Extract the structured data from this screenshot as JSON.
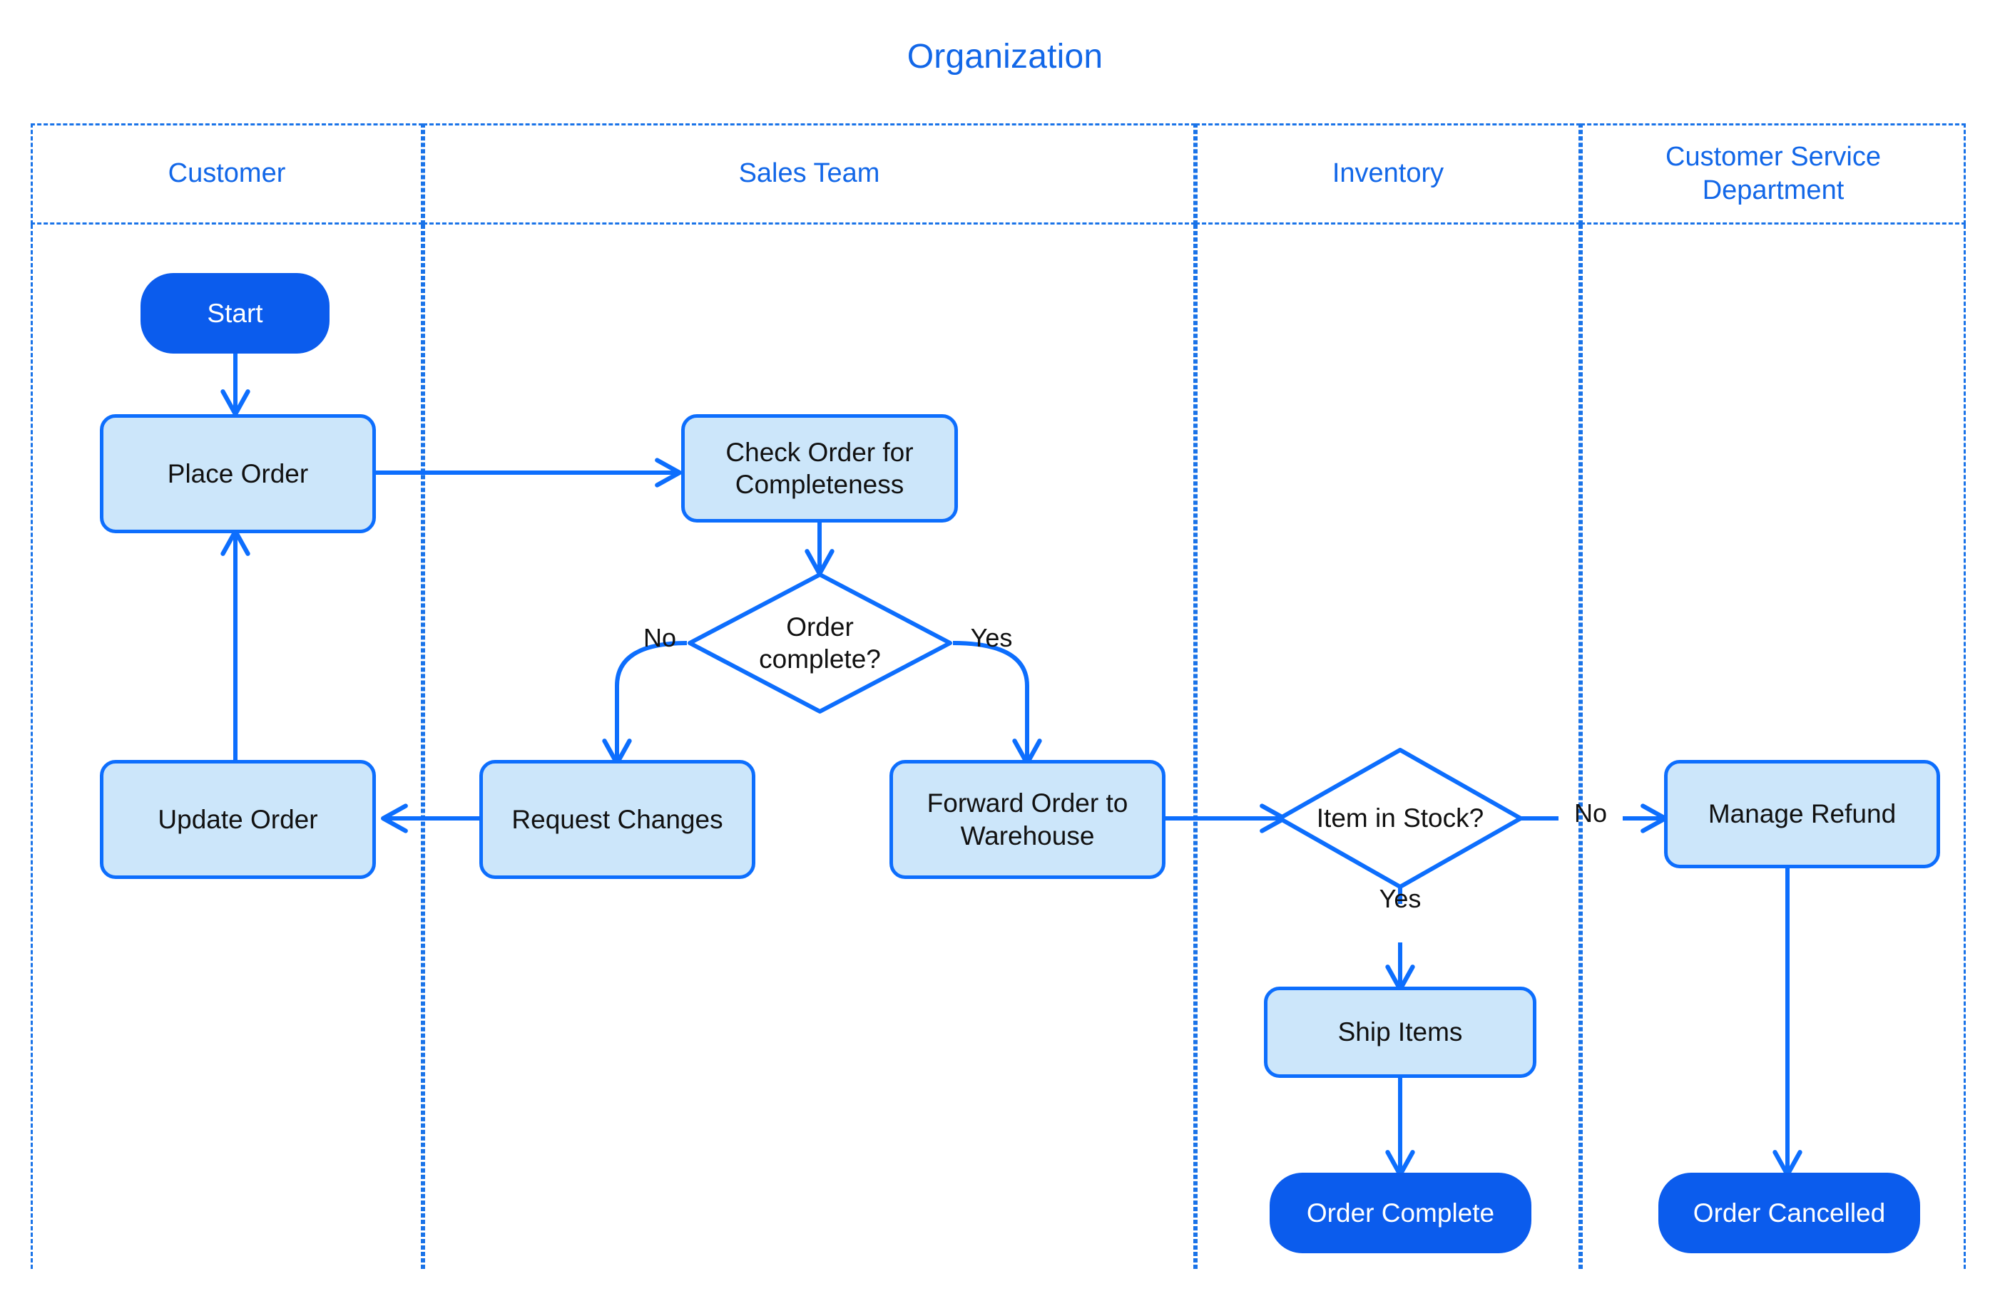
{
  "diagram": {
    "title": "Organization",
    "type": "swimlane-flowchart",
    "colors": {
      "accent": "#1267e8",
      "lane_border": "#1a73e8",
      "node_border": "#0d6efd",
      "process_fill": "#cce6fa",
      "terminator_fill": "#0b5ced",
      "terminator_text": "#ffffff",
      "node_text": "#111111",
      "connector": "#0d6efd"
    }
  },
  "lanes": [
    {
      "id": "customer",
      "label": "Customer"
    },
    {
      "id": "sales",
      "label": "Sales Team"
    },
    {
      "id": "inventory",
      "label": "Inventory"
    },
    {
      "id": "service",
      "label": "Customer Service Department"
    }
  ],
  "nodes": [
    {
      "id": "start",
      "label": "Start",
      "shape": "terminator",
      "lane": "customer"
    },
    {
      "id": "place-order",
      "label": "Place Order",
      "shape": "process",
      "lane": "customer"
    },
    {
      "id": "update-order",
      "label": "Update Order",
      "shape": "process",
      "lane": "customer"
    },
    {
      "id": "check-order",
      "label": "Check Order for Completeness",
      "shape": "process",
      "lane": "sales"
    },
    {
      "id": "order-complete",
      "label": "Order complete?",
      "shape": "decision",
      "lane": "sales"
    },
    {
      "id": "request-changes",
      "label": "Request Changes",
      "shape": "process",
      "lane": "sales"
    },
    {
      "id": "forward-order",
      "label": "Forward Order to Warehouse",
      "shape": "process",
      "lane": "sales"
    },
    {
      "id": "item-in-stock",
      "label": "Item in Stock?",
      "shape": "decision",
      "lane": "inventory"
    },
    {
      "id": "ship-items",
      "label": "Ship Items",
      "shape": "process",
      "lane": "inventory"
    },
    {
      "id": "order-complete-end",
      "label": "Order Complete",
      "shape": "terminator",
      "lane": "inventory"
    },
    {
      "id": "manage-refund",
      "label": "Manage Refund",
      "shape": "process",
      "lane": "service"
    },
    {
      "id": "order-cancelled",
      "label": "Order Cancelled",
      "shape": "terminator",
      "lane": "service"
    }
  ],
  "edges": [
    {
      "from": "start",
      "to": "place-order",
      "label": ""
    },
    {
      "from": "place-order",
      "to": "check-order",
      "label": ""
    },
    {
      "from": "check-order",
      "to": "order-complete",
      "label": ""
    },
    {
      "from": "order-complete",
      "to": "request-changes",
      "label": "No"
    },
    {
      "from": "order-complete",
      "to": "forward-order",
      "label": "Yes"
    },
    {
      "from": "request-changes",
      "to": "update-order",
      "label": ""
    },
    {
      "from": "update-order",
      "to": "place-order",
      "label": ""
    },
    {
      "from": "forward-order",
      "to": "item-in-stock",
      "label": ""
    },
    {
      "from": "item-in-stock",
      "to": "manage-refund",
      "label": "No"
    },
    {
      "from": "item-in-stock",
      "to": "ship-items",
      "label": "Yes"
    },
    {
      "from": "ship-items",
      "to": "order-complete-end",
      "label": ""
    },
    {
      "from": "manage-refund",
      "to": "order-cancelled",
      "label": ""
    }
  ],
  "edge_labels": {
    "order_complete_no": "No",
    "order_complete_yes": "Yes",
    "item_in_stock_no": "No",
    "item_in_stock_yes": "Yes"
  }
}
